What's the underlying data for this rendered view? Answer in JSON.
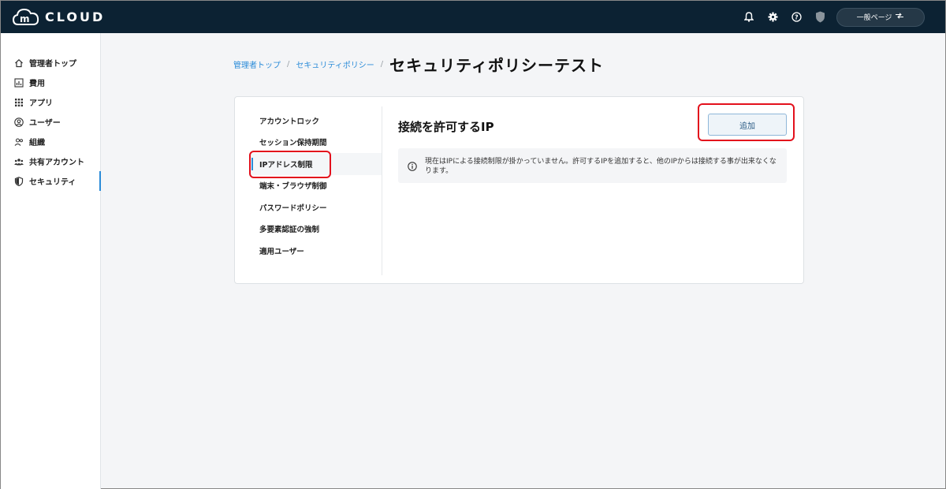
{
  "topbar": {
    "logo_letter": "m",
    "logo_text": "CLOUD",
    "general_page_label": "一般ページ",
    "icons": [
      "bell-icon",
      "gear-icon",
      "help-icon",
      "shield-icon"
    ]
  },
  "sidebar": {
    "items": [
      {
        "label": "管理者トップ",
        "icon": "home-icon"
      },
      {
        "label": "費用",
        "icon": "chart-icon"
      },
      {
        "label": "アプリ",
        "icon": "grid-icon"
      },
      {
        "label": "ユーザー",
        "icon": "user-icon"
      },
      {
        "label": "組織",
        "icon": "group-icon"
      },
      {
        "label": "共有アカウント",
        "icon": "shared-users-icon"
      },
      {
        "label": "セキュリティ",
        "icon": "shield-icon"
      }
    ],
    "active_index": 6
  },
  "breadcrumb": {
    "items": [
      "管理者トップ",
      "セキュリティポリシー"
    ],
    "separator": "/",
    "current": "セキュリティポリシーテスト"
  },
  "policy_menu": {
    "items": [
      "アカウントロック",
      "セッション保持期間",
      "IPアドレス制限",
      "端末・ブラウザ制御",
      "パスワードポリシー",
      "多要素認証の強制",
      "適用ユーザー"
    ],
    "active_index": 2
  },
  "section": {
    "title": "接続を許可するIP",
    "add_button": "追加",
    "notice": "現在はIPによる接続制限が掛かっていません。許可するIPを追加すると、他のIPからは接続する事が出来なくなります。"
  },
  "colors": {
    "topbar": "#0c2233",
    "accent": "#2a8bd8",
    "highlight": "#e3101c"
  }
}
